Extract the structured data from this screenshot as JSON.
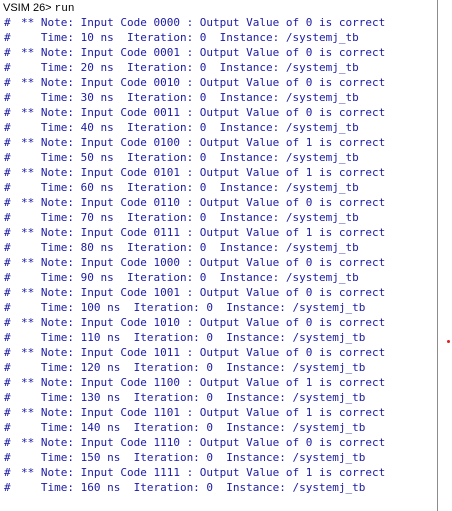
{
  "prompt": {
    "label": "VSIM 26>",
    "command": "run"
  },
  "log_lines": [
    {
      "prefix": "#",
      "text": "** Note: Input Code 0000 : Output Value of 0 is correct"
    },
    {
      "prefix": "#",
      "text": "   Time: 10 ns  Iteration: 0  Instance: /systemj_tb"
    },
    {
      "prefix": "#",
      "text": "** Note: Input Code 0001 : Output Value of 0 is correct"
    },
    {
      "prefix": "#",
      "text": "   Time: 20 ns  Iteration: 0  Instance: /systemj_tb"
    },
    {
      "prefix": "#",
      "text": "** Note: Input Code 0010 : Output Value of 0 is correct"
    },
    {
      "prefix": "#",
      "text": "   Time: 30 ns  Iteration: 0  Instance: /systemj_tb"
    },
    {
      "prefix": "#",
      "text": "** Note: Input Code 0011 : Output Value of 0 is correct"
    },
    {
      "prefix": "#",
      "text": "   Time: 40 ns  Iteration: 0  Instance: /systemj_tb"
    },
    {
      "prefix": "#",
      "text": "** Note: Input Code 0100 : Output Value of 1 is correct"
    },
    {
      "prefix": "#",
      "text": "   Time: 50 ns  Iteration: 0  Instance: /systemj_tb"
    },
    {
      "prefix": "#",
      "text": "** Note: Input Code 0101 : Output Value of 1 is correct"
    },
    {
      "prefix": "#",
      "text": "   Time: 60 ns  Iteration: 0  Instance: /systemj_tb"
    },
    {
      "prefix": "#",
      "text": "** Note: Input Code 0110 : Output Value of 0 is correct"
    },
    {
      "prefix": "#",
      "text": "   Time: 70 ns  Iteration: 0  Instance: /systemj_tb"
    },
    {
      "prefix": "#",
      "text": "** Note: Input Code 0111 : Output Value of 1 is correct"
    },
    {
      "prefix": "#",
      "text": "   Time: 80 ns  Iteration: 0  Instance: /systemj_tb"
    },
    {
      "prefix": "#",
      "text": "** Note: Input Code 1000 : Output Value of 0 is correct"
    },
    {
      "prefix": "#",
      "text": "   Time: 90 ns  Iteration: 0  Instance: /systemj_tb"
    },
    {
      "prefix": "#",
      "text": "** Note: Input Code 1001 : Output Value of 0 is correct"
    },
    {
      "prefix": "#",
      "text": "   Time: 100 ns  Iteration: 0  Instance: /systemj_tb"
    },
    {
      "prefix": "#",
      "text": "** Note: Input Code 1010 : Output Value of 0 is correct"
    },
    {
      "prefix": "#",
      "text": "   Time: 110 ns  Iteration: 0  Instance: /systemj_tb"
    },
    {
      "prefix": "#",
      "text": "** Note: Input Code 1011 : Output Value of 0 is correct"
    },
    {
      "prefix": "#",
      "text": "   Time: 120 ns  Iteration: 0  Instance: /systemj_tb"
    },
    {
      "prefix": "#",
      "text": "** Note: Input Code 1100 : Output Value of 1 is correct"
    },
    {
      "prefix": "#",
      "text": "   Time: 130 ns  Iteration: 0  Instance: /systemj_tb"
    },
    {
      "prefix": "#",
      "text": "** Note: Input Code 1101 : Output Value of 1 is correct"
    },
    {
      "prefix": "#",
      "text": "   Time: 140 ns  Iteration: 0  Instance: /systemj_tb"
    },
    {
      "prefix": "#",
      "text": "** Note: Input Code 1110 : Output Value of 0 is correct"
    },
    {
      "prefix": "#",
      "text": "   Time: 150 ns  Iteration: 0  Instance: /systemj_tb"
    },
    {
      "prefix": "#",
      "text": "** Note: Input Code 1111 : Output Value of 1 is correct"
    },
    {
      "prefix": "#",
      "text": "   Time: 160 ns  Iteration: 0  Instance: /systemj_tb"
    }
  ],
  "colors": {
    "log_text": "#1a1aa6",
    "prompt_text": "#000000",
    "marker_dot": "#e02020",
    "background": "#ffffff"
  }
}
